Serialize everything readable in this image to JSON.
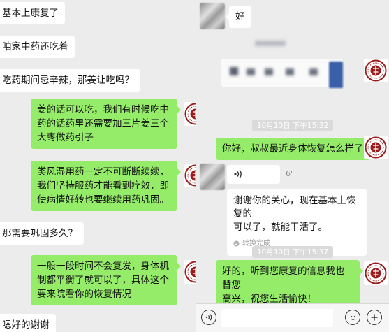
{
  "left_chat": {
    "messages": [
      {
        "side": "left",
        "text": "基本上康复了"
      },
      {
        "side": "left",
        "text": "咱家中药还吃着"
      },
      {
        "side": "left",
        "text": "吃药期间忌辛辣，那姜让吃吗？"
      },
      {
        "side": "right",
        "lines": [
          "姜的话可以吃，我们有时候吃中",
          "药的话药里还需要加三片姜三个",
          "大枣做药引子"
        ]
      },
      {
        "side": "right",
        "lines": [
          "类风湿用药一定不可断断续续，",
          "我们坚持服药才能看到疗效，即",
          "使病情好转也要继续用药巩固。"
        ]
      },
      {
        "side": "left",
        "text": "那需要巩固多久？"
      },
      {
        "side": "right",
        "lines": [
          "一般一段时间不会复发，身体机",
          "制都平衡了就可以了，具体这个",
          "要来院看你的恢复情况"
        ]
      },
      {
        "side": "left",
        "text": "嗯好的谢谢"
      }
    ]
  },
  "right_chat": {
    "first_message": "好",
    "timestamp_1": "10月10日 下午15:32",
    "reply_1": "你好，叔叔最近身体恢复怎么样了",
    "voice_duration": "6\"",
    "voice_note_lines": [
      "谢谢你的关心，现在基本上恢复的",
      "可以了，就能干活了。"
    ],
    "voice_note_status": "转换完成",
    "timestamp_2": "10月10日 下午15:37",
    "reply_2_lines": [
      "好的，听到您康复的信息我也替您",
      "高兴，祝您生活愉快！"
    ]
  },
  "icons": {
    "voice_toggle": "voice-icon",
    "emoji": "emoji-icon",
    "more": "plus-icon",
    "sound_wave": "sound-wave-icon",
    "check": "check-icon"
  },
  "colors": {
    "bubble_green": "#95ec69",
    "bubble_white": "#ffffff",
    "seal_red": "#9b1c1c",
    "background": "#ececec"
  }
}
